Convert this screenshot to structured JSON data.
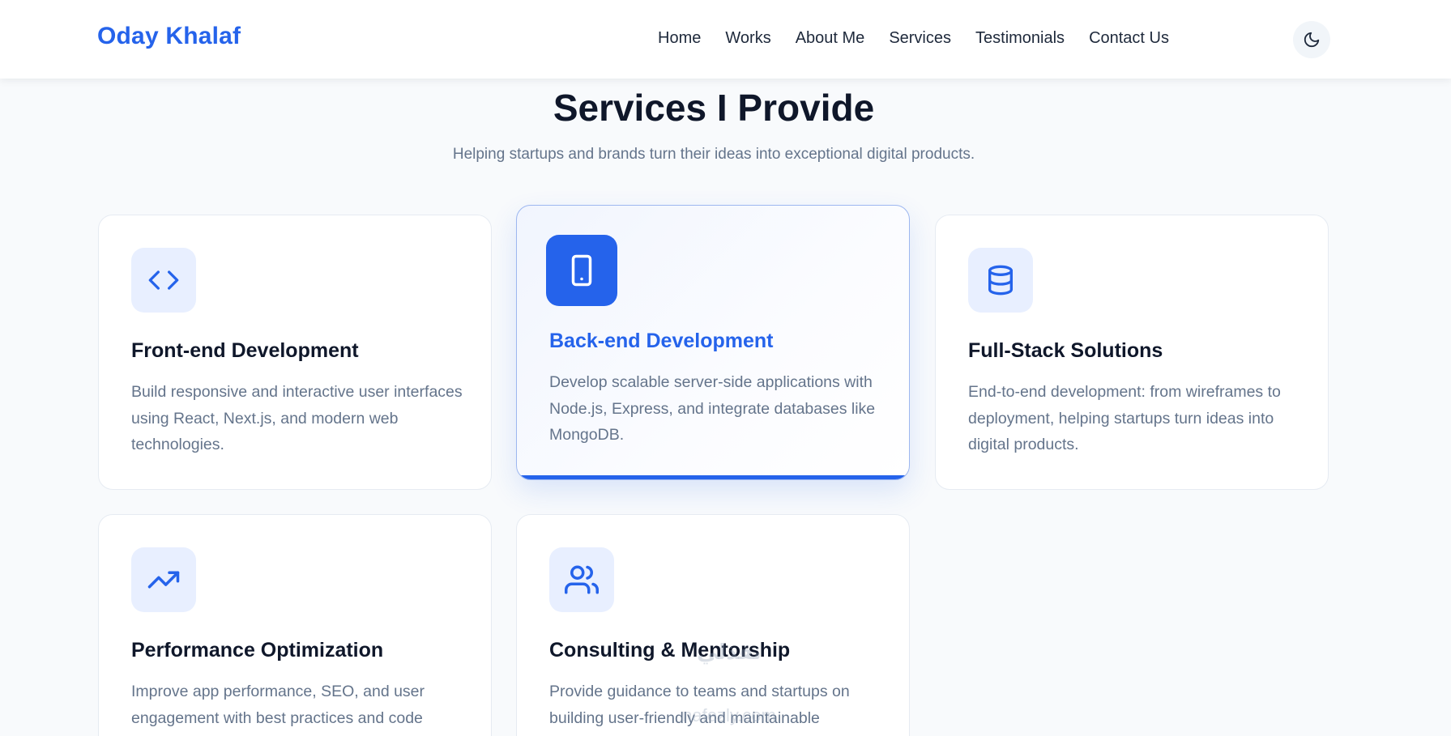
{
  "header": {
    "logo": "Oday Khalaf",
    "nav": [
      {
        "label": "Home",
        "name": "nav-home"
      },
      {
        "label": "Works",
        "name": "nav-works"
      },
      {
        "label": "About Me",
        "name": "nav-about-me"
      },
      {
        "label": "Services",
        "name": "nav-services"
      },
      {
        "label": "Testimonials",
        "name": "nav-testimonials"
      },
      {
        "label": "Contact Us",
        "name": "nav-contact-us"
      }
    ],
    "theme_toggle_icon": "moon-icon"
  },
  "section": {
    "title": "Services I Provide",
    "subtitle": "Helping startups and brands turn their ideas into exceptional digital products."
  },
  "services": [
    {
      "title": "Front-end Development",
      "text": "Build responsive and interactive user interfaces using React, Next.js, and modern web technologies.",
      "icon": "code-icon"
    },
    {
      "title": "Back-end Development",
      "text": "Develop scalable server-side applications with Node.js, Express, and integrate databases like MongoDB.",
      "icon": "tablet-icon",
      "active": true
    },
    {
      "title": "Full-Stack Solutions",
      "text": "End-to-end development: from wireframes to deployment, helping startups turn ideas into digital products.",
      "icon": "database-icon"
    },
    {
      "title": "Performance Optimization",
      "text": "Improve app performance, SEO, and user engagement with best practices and code",
      "icon": "trending-up-icon"
    },
    {
      "title": "Consulting & Mentorship",
      "text": "Provide guidance to teams and startups on building user-friendly and maintainable",
      "icon": "users-icon"
    }
  ],
  "colors": {
    "accent": "#2563eb",
    "icon_bg": "#e8efff",
    "heading": "#0f172a",
    "body_text": "#64748b"
  },
  "watermark": {
    "logo_text": "نفذلي",
    "site": "nafezly.com"
  }
}
